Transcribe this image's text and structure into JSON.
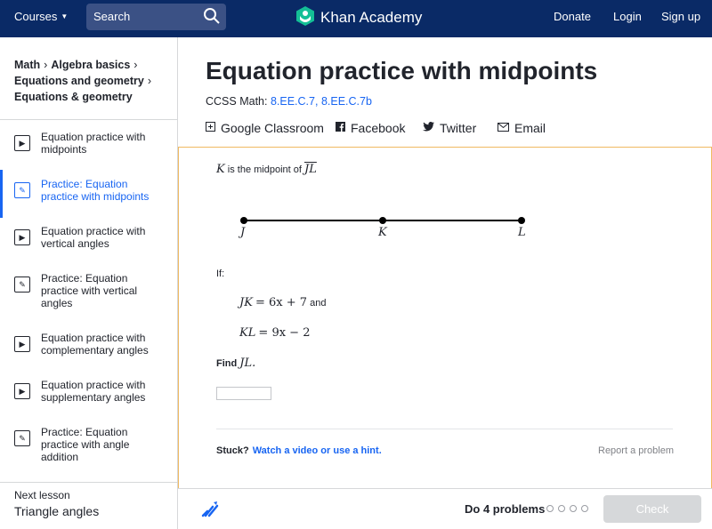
{
  "topbar": {
    "courses_label": "Courses",
    "search_label": "Search",
    "brand": "Khan Academy",
    "donate": "Donate",
    "login": "Login",
    "signup": "Sign up"
  },
  "breadcrumbs": [
    "Math",
    "Algebra basics",
    "Equations and geometry",
    "Equations & geometry"
  ],
  "sidebar": {
    "items": [
      {
        "label": "Equation practice with midpoints",
        "icon": "play-icon"
      },
      {
        "label": "Practice: Equation practice with midpoints",
        "icon": "pencil-icon"
      },
      {
        "label": "Equation practice with vertical angles",
        "icon": "play-icon"
      },
      {
        "label": "Practice: Equation practice with vertical angles",
        "icon": "pencil-icon"
      },
      {
        "label": "Equation practice with complementary angles",
        "icon": "play-icon"
      },
      {
        "label": "Equation practice with supplementary angles",
        "icon": "play-icon"
      },
      {
        "label": "Practice: Equation practice with angle addition",
        "icon": "pencil-icon"
      }
    ],
    "next_label": "Next lesson",
    "next_value": "Triangle angles"
  },
  "page": {
    "title": "Equation practice with midpoints",
    "ccss_prefix": "CCSS Math:",
    "ccss_links": [
      "8.EE.C.7,",
      "8.EE.C.7b"
    ],
    "share": {
      "classroom": "Google Classroom",
      "facebook": "Facebook",
      "twitter": "Twitter",
      "email": "Email"
    }
  },
  "exercise": {
    "intro_var": "K",
    "intro_text": "is the midpoint of",
    "intro_seg": "JL",
    "points": [
      "J",
      "K",
      "L"
    ],
    "if_label": "If:",
    "eq1_lhs": "JK",
    "eq1_rhs": "= 6x + 7",
    "eq1_and": "and",
    "eq2_lhs": "KL",
    "eq2_rhs": "= 9x − 2",
    "find_label": "Find",
    "find_var": "JL.",
    "stuck": "Stuck?",
    "hint_link": "Watch a video or use a hint.",
    "report": "Report a problem"
  },
  "footer": {
    "do_label": "Do 4 problems",
    "check_label": "Check"
  }
}
